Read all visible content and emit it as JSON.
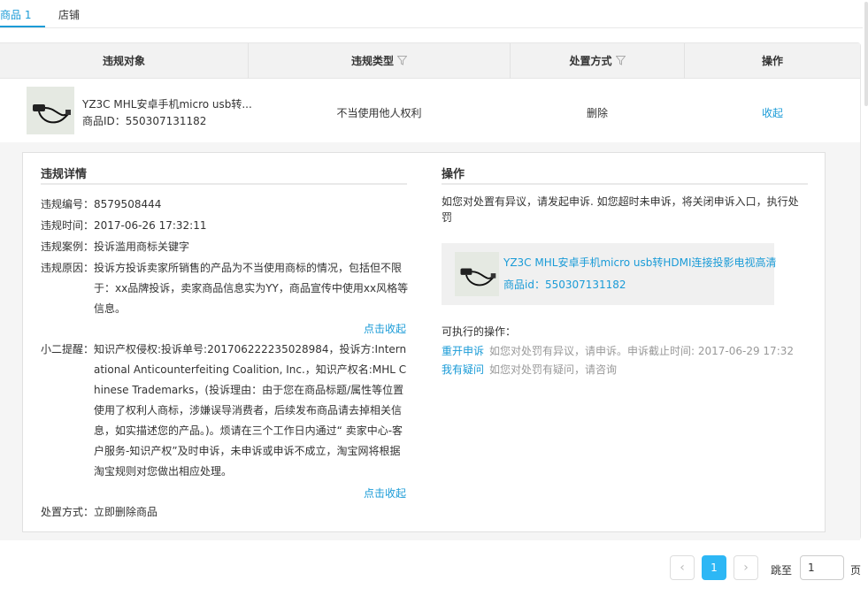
{
  "tabs": [
    {
      "label": "商品 1"
    },
    {
      "label": "店铺"
    }
  ],
  "table": {
    "headers": {
      "object": "违规对象",
      "type": "违规类型",
      "method": "处置方式",
      "op": "操作"
    },
    "row": {
      "title": "YZ3C MHL安卓手机micro usb转...",
      "id_text": "商品ID：550307131182",
      "type": "不当使用他人权利",
      "method": "删除",
      "op": "收起"
    }
  },
  "detail": {
    "left_title": "违规详情",
    "number_label": "违规编号：",
    "number": "8579508444",
    "time_label": "违规时间：",
    "time": "2017-06-26 17:32:11",
    "case_label": "违规案例：",
    "case": "投诉滥用商标关键字",
    "reason_label": "违规原因：",
    "reason": "投诉方投诉卖家所销售的产品为不当使用商标的情况，包括但不限于：xx品牌投诉，卖家商品信息实为YY，商品宣传中使用xx风格等信息。",
    "fold1": "点击收起",
    "tip_label": "小二提醒：",
    "tip": "知识产权侵权:投诉单号:201706222235028984，投诉方:International Anticounterfeiting Coalition, Inc.，知识产权名:MHL Chinese Trademarks，(投诉理由：由于您在商品标题/属性等位置使用了权利人商标，涉嫌误导消费者，后续发布商品请去掉相关信息，如实描述您的产品。)。烦请在三个工作日内通过“ 卖家中心-客户服务-知识产权”及时申诉，未申诉或申诉不成立，淘宝网将根据淘宝规则对您做出相应处理。",
    "fold2": "点击收起",
    "handle_label": "处置方式：",
    "handle": "立即删除商品",
    "right_title": "操作",
    "right_text": "如您对处置有异议，请发起申诉. 如您超时未申诉，将关闭申诉入口，执行处罚",
    "card_title": "YZ3C MHL安卓手机micro usb转HDMI连接投影电视高清",
    "card_id": "商品id：550307131182",
    "avail_label": "可执行的操作：",
    "actions": [
      {
        "link": "重开申诉",
        "hint": "如您对处罚有异议，请申诉。申诉截止时间: 2017-06-29 17:32"
      },
      {
        "link": "我有疑问",
        "hint": "如您对处罚有疑问，请咨询"
      }
    ]
  },
  "pager": {
    "prev": "‹",
    "current": "1",
    "next": "›",
    "jump_label": "跳至",
    "jump_value": "1",
    "page_suffix": "页"
  },
  "colors": {
    "accent": "#1a9bd7",
    "pager_active": "#2db7f5"
  },
  "icons": {
    "filter": "funnel-filter-icon",
    "prev": "chevron-left-icon",
    "next": "chevron-right-icon"
  }
}
